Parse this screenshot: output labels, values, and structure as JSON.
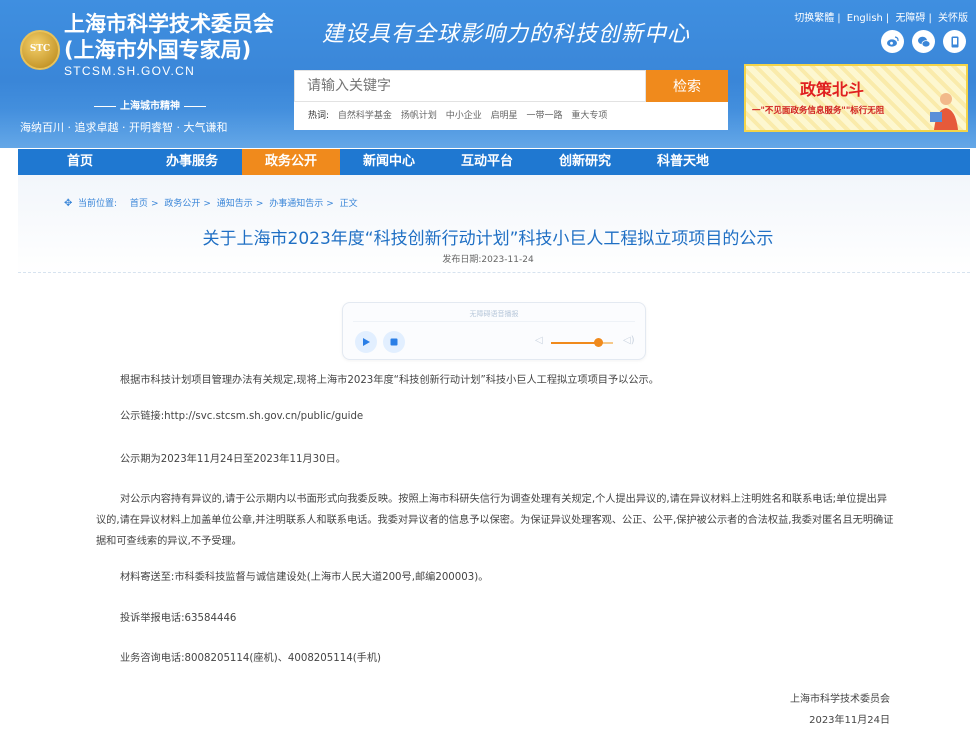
{
  "header": {
    "logo_text": "STC",
    "org_name_line1": "上海市科学技术委员会",
    "org_name_line2": "(上海市外国专家局)",
    "domain": "STCSM.SH.GOV.CN",
    "spirit_title": "上海城市精神",
    "spirit_text": "海纳百川 · 追求卓越 · 开明睿智 · 大气谦和",
    "slogan": "建设具有全球影响力的科技创新中心",
    "top_links": [
      "切换繁體",
      "English",
      "无障碍",
      "关怀版"
    ],
    "social_icons": [
      "weibo-icon",
      "wechat-icon",
      "app-icon"
    ]
  },
  "search": {
    "placeholder": "请输入关键字",
    "button_label": "检索",
    "hot_label": "热词:",
    "hot_words": [
      "自然科学基金",
      "扬帆计划",
      "中小企业",
      "启明星",
      "一带一路",
      "重大专项"
    ]
  },
  "banner": {
    "title": "政策北斗",
    "subtitle": "一\"不见面政务信息服务\"\"标行无阻"
  },
  "nav": {
    "items": [
      {
        "label": "首页",
        "active": false
      },
      {
        "label": "办事服务",
        "active": false
      },
      {
        "label": "政务公开",
        "active": true
      },
      {
        "label": "新闻中心",
        "active": false
      },
      {
        "label": "互动平台",
        "active": false
      },
      {
        "label": "创新研究",
        "active": false
      },
      {
        "label": "科普天地",
        "active": false
      }
    ]
  },
  "breadcrumb": {
    "label": "当前位置:",
    "items": [
      "首页",
      "政务公开",
      "通知告示",
      "办事通知告示",
      "正文"
    ]
  },
  "article": {
    "title": "关于上海市2023年度“科技创新行动计划”科技小巨人工程拟立项项目的公示",
    "publish_date": "发布日期:2023-11-24",
    "player_label": "无障碍语音播报",
    "volume_level": 0.75,
    "paragraphs": [
      "根据市科技计划项目管理办法有关规定,现将上海市2023年度“科技创新行动计划”科技小巨人工程拟立项项目予以公示。",
      "公示链接:http://svc.stcsm.sh.gov.cn/public/guide",
      "公示期为2023年11月24日至2023年11月30日。",
      "对公示内容持有异议的,请于公示期内以书面形式向我委反映。按照上海市科研失信行为调查处理有关规定,个人提出异议的,请在异议材料上注明姓名和联系电话;单位提出异议的,请在异议材料上加盖单位公章,并注明联系人和联系电话。我委对异议者的信息予以保密。为保证异议处理客观、公正、公平,保护被公示者的合法权益,我委对匿名且无明确证据和可查线索的异议,不予受理。",
      "材料寄送至:市科委科技监督与诚信建设处(上海市人民大道200号,邮编200003)。",
      "投诉举报电话:63584446",
      "业务咨询电话:8008205114(座机)、4008205114(手机)"
    ],
    "signature_org": "上海市科学技术委员会",
    "signature_date": "2023年11月24日"
  },
  "colors": {
    "header_blue": "#3a86d8",
    "nav_blue": "#1f78d1",
    "accent_orange": "#f08a1c",
    "title_blue": "#1f6fc4"
  }
}
